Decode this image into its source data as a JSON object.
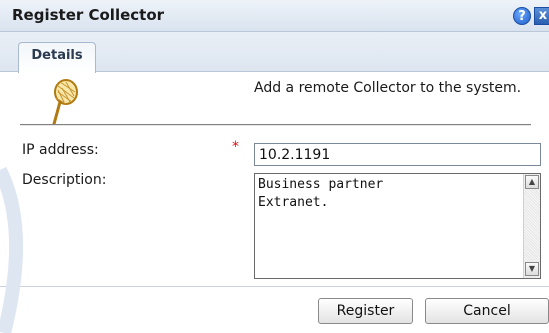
{
  "dialog": {
    "title": "Register Collector",
    "help_symbol": "?",
    "close_symbol": "x"
  },
  "tabs": [
    {
      "label": "Details",
      "active": true
    }
  ],
  "header": {
    "icon": "collector-net-icon",
    "description": "Add a remote Collector to the system."
  },
  "form": {
    "ip_label": "IP address:",
    "required_mark": "*",
    "ip_value": "10.2.1191",
    "description_label": "Description:",
    "description_value": "Business partner\nExtranet."
  },
  "buttons": {
    "register_label": "Register",
    "cancel_label": "Cancel"
  },
  "colors": {
    "accent": "#1f5fc9",
    "required": "#e01010",
    "icon_orange": "#e0a020"
  }
}
